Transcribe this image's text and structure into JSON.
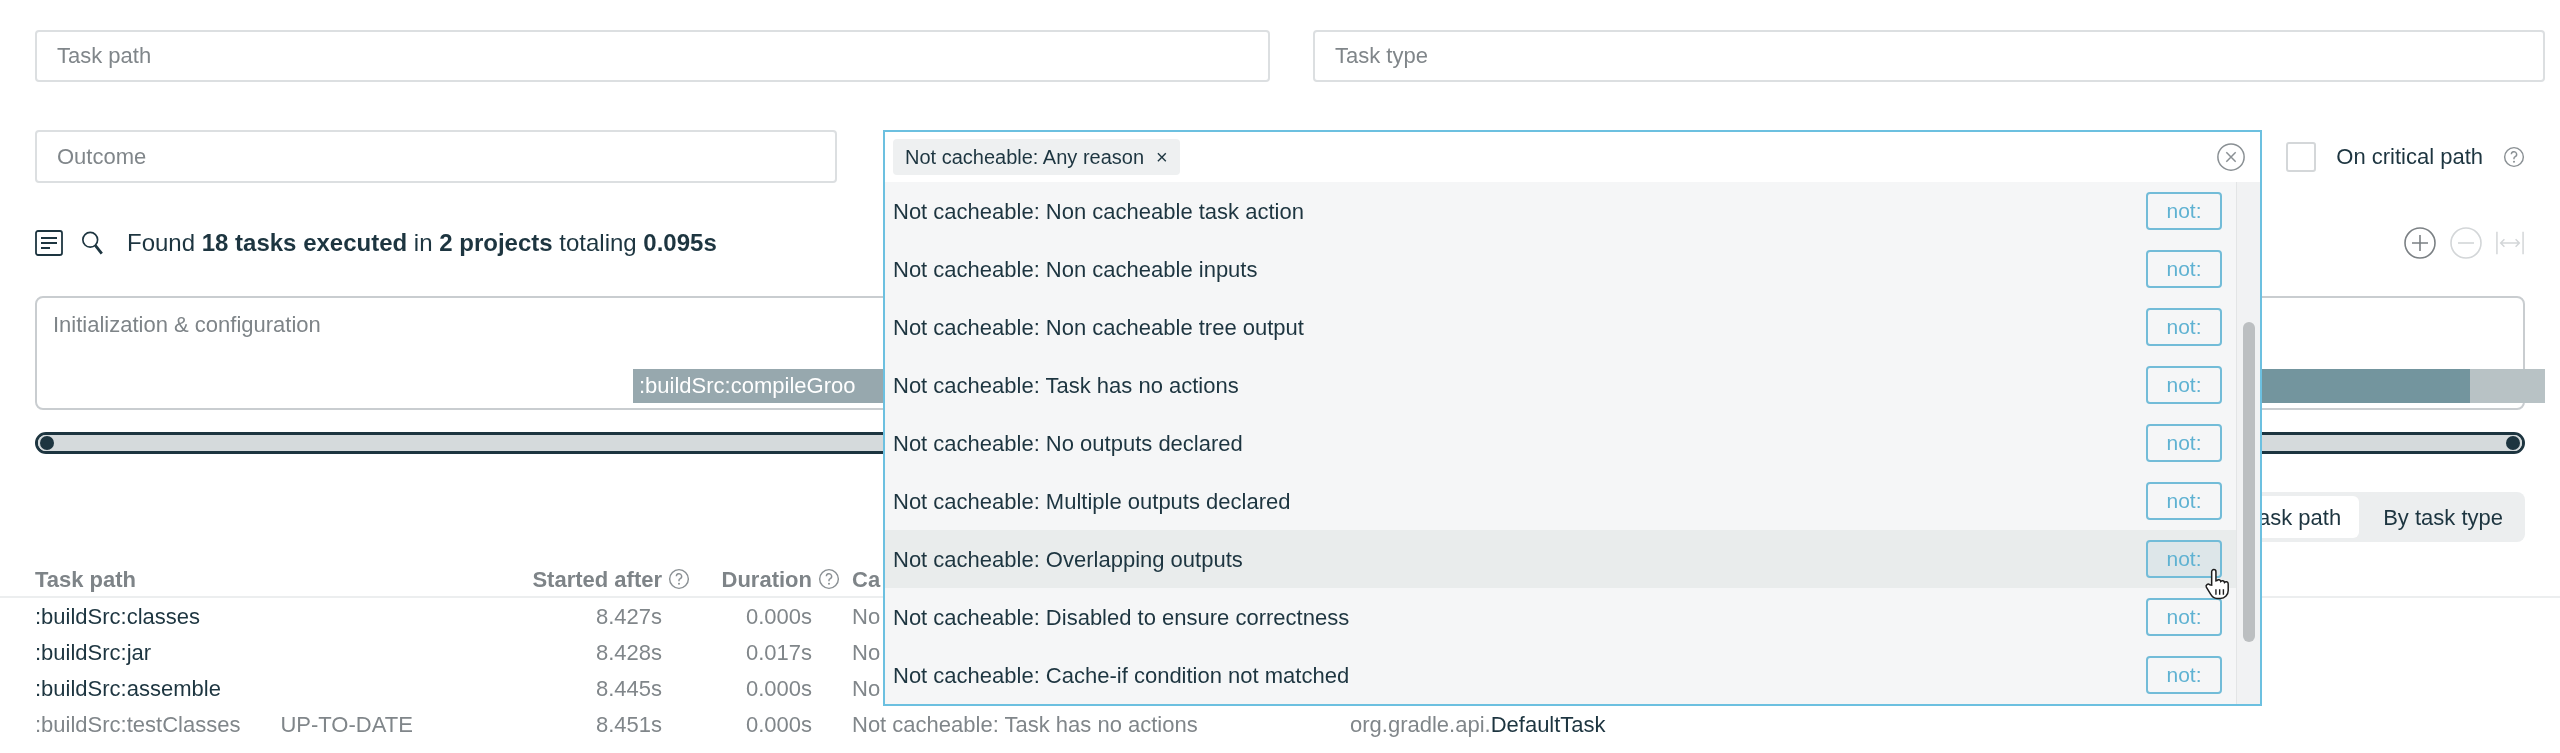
{
  "filters": {
    "task_path": {
      "placeholder": "Task path"
    },
    "task_type": {
      "placeholder": "Task type"
    },
    "outcome": {
      "placeholder": "Outcome"
    }
  },
  "cacheability": {
    "chips": [
      {
        "label": "Not cacheable: Any reason",
        "remove": "×"
      }
    ],
    "options": [
      {
        "label": "Not cacheable: Non cacheable task action",
        "negate": "not:",
        "highlighted": false
      },
      {
        "label": "Not cacheable: Non cacheable inputs",
        "negate": "not:",
        "highlighted": false
      },
      {
        "label": "Not cacheable: Non cacheable tree output",
        "negate": "not:",
        "highlighted": false
      },
      {
        "label": "Not cacheable: Task has no actions",
        "negate": "not:",
        "highlighted": false
      },
      {
        "label": "Not cacheable: No outputs declared",
        "negate": "not:",
        "highlighted": false
      },
      {
        "label": "Not cacheable: Multiple outputs declared",
        "negate": "not:",
        "highlighted": false
      },
      {
        "label": "Not cacheable: Overlapping outputs",
        "negate": "not:",
        "highlighted": true
      },
      {
        "label": "Not cacheable: Disabled to ensure correctness",
        "negate": "not:",
        "highlighted": false
      },
      {
        "label": "Not cacheable: Cache-if condition not matched",
        "negate": "not:",
        "highlighted": false
      }
    ]
  },
  "critical_path": {
    "label": "On critical path",
    "checked": false
  },
  "summary": "Found **18 tasks executed** in **2 projects** totaling **0.095s**",
  "timeline": {
    "title": "Initialization & configuration",
    "bars": [
      {
        "label": ":buildSrc:compileGroo"
      }
    ]
  },
  "timeline_range": {
    "level": 1
  },
  "group_tabs": [
    {
      "label": "ask path",
      "selected": true
    },
    {
      "label": "By task type",
      "selected": false
    }
  ],
  "table": {
    "columns": [
      {
        "label": "Task path",
        "help": false
      },
      {
        "label": "Started after",
        "help": true
      },
      {
        "label": "Duration",
        "help": true
      },
      {
        "label": "Ca",
        "help": false
      }
    ],
    "rows": [
      {
        "task_path": ":buildSrc:classes",
        "started_after": "8.427s",
        "duration": "0.000s",
        "cacheable": "No",
        "dimmed": false
      },
      {
        "task_path": ":buildSrc:jar",
        "started_after": "8.428s",
        "duration": "0.017s",
        "cacheable": "No",
        "dimmed": false
      },
      {
        "task_path": ":buildSrc:assemble",
        "started_after": "8.445s",
        "duration": "0.000s",
        "cacheable": "No",
        "dimmed": false
      },
      {
        "task_path": ":buildSrc:testClasses",
        "outcome": "UP-TO-DATE",
        "started_after": "8.451s",
        "duration": "0.000s",
        "cacheable": "Not cacheable: Task has no actions",
        "type_package": "org.gradle.api.",
        "type_name": "DefaultTask",
        "dimmed": true
      }
    ]
  }
}
